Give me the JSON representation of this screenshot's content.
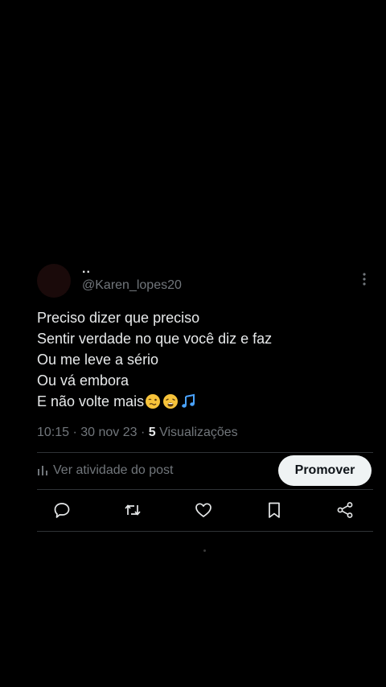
{
  "post": {
    "display_name": "..",
    "handle": "@Karen_lopes20",
    "lines": [
      "Preciso dizer que preciso",
      "Sentir verdade no que você diz e faz",
      "Ou me leve a sério",
      "Ou vá embora",
      "E não volte mais"
    ],
    "emojis": [
      "woozy-face-emoji",
      "weary-face-emoji",
      "musical-notes-emoji"
    ],
    "time": "10:15 · 30 nov 23 · ",
    "views_count": "5",
    "views_label": " Visualizações"
  },
  "activity": {
    "label": "Ver atividade do post",
    "icon": "bar-chart-icon"
  },
  "promote_button": {
    "label": "Promover"
  },
  "action_icons": [
    "reply-icon",
    "repost-icon",
    "like-icon",
    "bookmark-icon",
    "share-icon"
  ],
  "colors": {
    "background": "#000000",
    "text": "#e7e9ea",
    "secondary_text": "#71767b",
    "divider": "#2f3336",
    "button_bg": "#eff3f4",
    "button_text": "#0f1419"
  }
}
